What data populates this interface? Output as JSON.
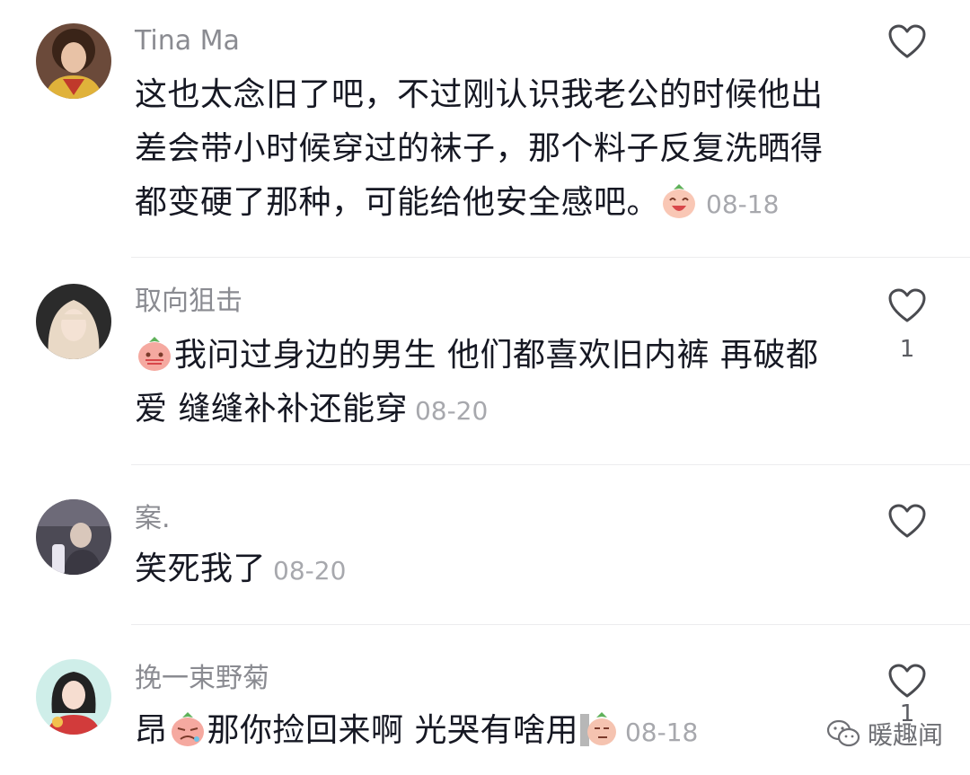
{
  "comments": [
    {
      "username": "Tina Ma",
      "text": "这也太念旧了吧，不过刚认识我老公的时候他出差会带小时候穿过的袜子，那个料子反复洗晒得都变硬了那种，可能给他安全感吧。",
      "emoji": "laughing-peach-emoji",
      "date": "08-18",
      "likes": ""
    },
    {
      "username": "取向狙击",
      "emoji": "embarrassed-peach-emoji",
      "text": "我问过身边的男生 他们都喜欢旧内裤 再破都爱 缝缝补补还能穿",
      "date": "08-20",
      "likes": "1"
    },
    {
      "username": "案.",
      "text": "笑死我了",
      "date": "08-20",
      "likes": ""
    },
    {
      "username": "挽一束野菊",
      "text_prefix": "昂",
      "emoji_1": "crying-peach-emoji",
      "text": "那你捡回来啊 光哭有啥用",
      "emoji_2": "peeking-peach-emoji",
      "date": "08-18",
      "likes": "1"
    }
  ],
  "watermark": {
    "label": "暖趣闻",
    "icon": "wechat-icon"
  },
  "colors": {
    "username": "#8a8b91",
    "text": "#161823",
    "date": "#a7a8ad",
    "divider": "#ececee"
  }
}
